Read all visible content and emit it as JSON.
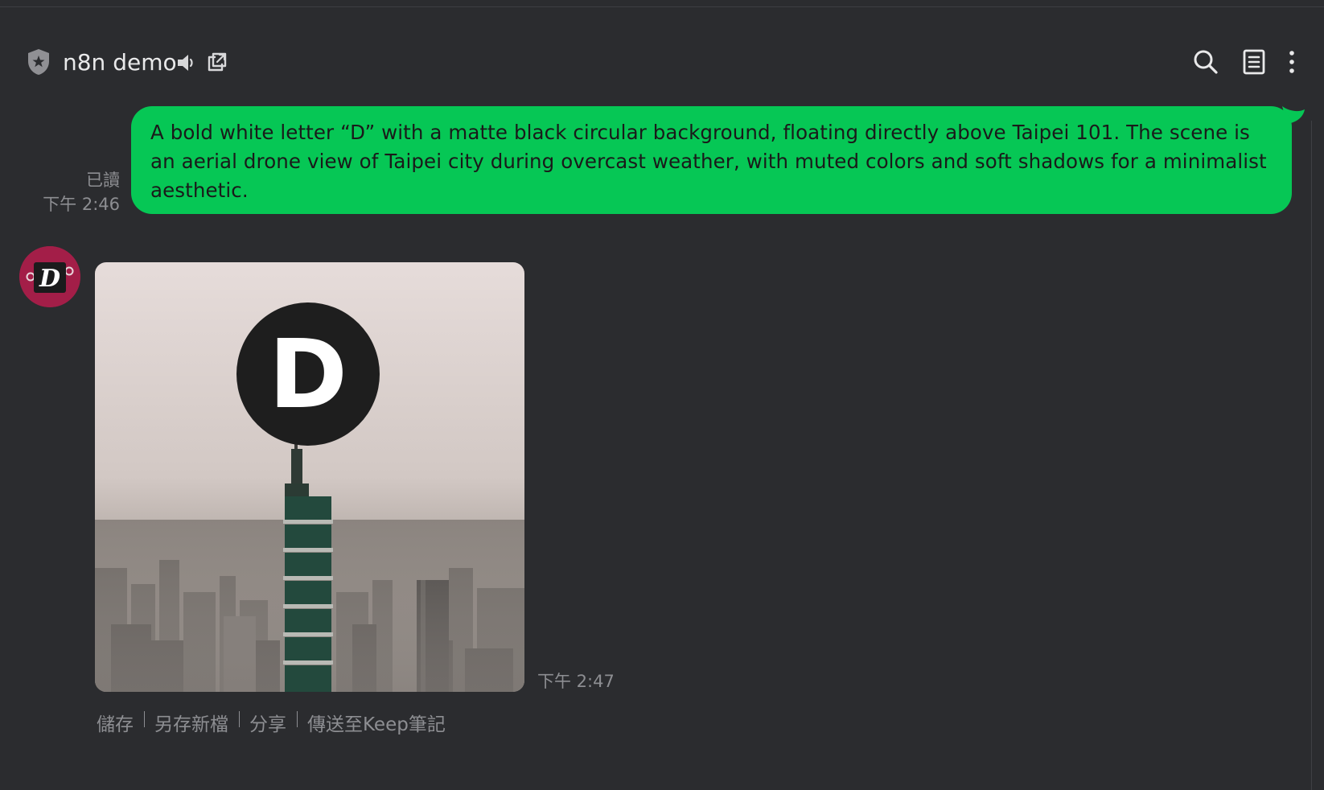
{
  "header": {
    "title": "n8n demo",
    "icons": [
      "shield-star-icon",
      "speaker-mute-icon",
      "popout-icon",
      "search-icon",
      "notes-icon",
      "more-vertical-icon"
    ]
  },
  "messages": {
    "sent": {
      "text": "A bold white letter “D” with a matte black circular background, floating directly above Taipei 101. The scene is an aerial drone view of Taipei city during overcast weather, with muted colors and soft shadows for a minimalist aesthetic.",
      "read_status": "已讀",
      "time": "下午 2:46",
      "bubble_color": "#06c755"
    },
    "received": {
      "image_letter": "D",
      "time": "下午 2:47",
      "actions": {
        "save": "儲存",
        "save_as": "另存新檔",
        "share": "分享",
        "send_to_keep": "傳送至Keep筆記"
      }
    }
  },
  "avatar": {
    "letter": "D",
    "background": "#a31e48"
  },
  "colors": {
    "background": "#2b2c2f",
    "text_primary": "#e9e9ea",
    "text_muted": "#8d8e92"
  }
}
